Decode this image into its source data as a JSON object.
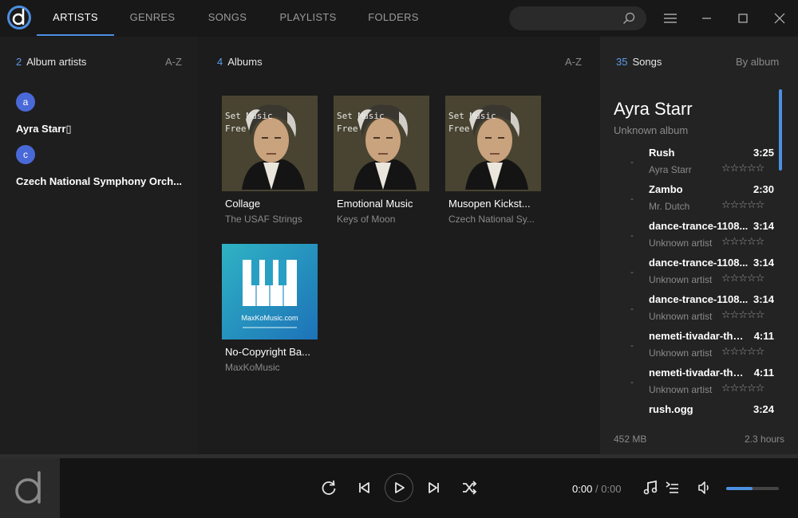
{
  "nav": {
    "tabs": [
      {
        "label": "ARTISTS",
        "active": true
      },
      {
        "label": "GENRES",
        "active": false
      },
      {
        "label": "SONGS",
        "active": false
      },
      {
        "label": "PLAYLISTS",
        "active": false
      },
      {
        "label": "FOLDERS",
        "active": false
      }
    ]
  },
  "search": {
    "value": "",
    "placeholder": ""
  },
  "album_artists_panel": {
    "count": "2",
    "title": "Album artists",
    "sort": "A-Z",
    "groups": [
      {
        "letter": "a",
        "artist": "Ayra Starr▯"
      },
      {
        "letter": "c",
        "artist": "Czech National Symphony Orch..."
      }
    ]
  },
  "albums_panel": {
    "count": "4",
    "title": "Albums",
    "sort": "A-Z",
    "albums": [
      {
        "title": "Collage",
        "artist": "The USAF Strings",
        "cover_text": [
          "Set Music",
          "Free"
        ],
        "cover": "portrait"
      },
      {
        "title": "Emotional Music",
        "artist": "Keys of Moon",
        "cover_text": [
          "Set Music",
          "Free"
        ],
        "cover": "portrait"
      },
      {
        "title": "Musopen Kickst...",
        "artist": "Czech National Sy...",
        "cover_text": [
          "Set Music",
          "Free"
        ],
        "cover": "portrait"
      },
      {
        "title": "No-Copyright Ba...",
        "artist": "MaxKoMusic",
        "cover_text": [
          "MaxKoMusic.com"
        ],
        "cover": "piano"
      }
    ]
  },
  "songs_panel": {
    "count": "35",
    "title": "Songs",
    "sort": "By album",
    "artist": "Ayra Starr",
    "album": "Unknown album",
    "songs": [
      {
        "title": "Rush",
        "duration": "3:25",
        "artist": "Ayra Starr",
        "rating": 0
      },
      {
        "title": "Zambo",
        "duration": "2:30",
        "artist": "Mr. Dutch",
        "rating": 0
      },
      {
        "title": "dance-trance-1108...",
        "duration": "3:14",
        "artist": "Unknown artist",
        "rating": 0
      },
      {
        "title": "dance-trance-1108...",
        "duration": "3:14",
        "artist": "Unknown artist",
        "rating": 0
      },
      {
        "title": "dance-trance-1108...",
        "duration": "3:14",
        "artist": "Unknown artist",
        "rating": 0
      },
      {
        "title": "nemeti-tivadar-the-...",
        "duration": "4:11",
        "artist": "Unknown artist",
        "rating": 0
      },
      {
        "title": "nemeti-tivadar-the-...",
        "duration": "4:11",
        "artist": "Unknown artist",
        "rating": 0
      },
      {
        "title": "rush.ogg",
        "duration": "3:24",
        "artist": "",
        "rating": 0
      }
    ],
    "size": "452 MB",
    "duration_total": "2.3 hours"
  },
  "player": {
    "current_time": "0:00",
    "separator": "/",
    "total_time": "0:00",
    "volume": 0.5,
    "icons": [
      "loop-icon",
      "previous-icon",
      "play-icon",
      "next-icon",
      "shuffle-icon",
      "now-playing-icon",
      "queue-icon",
      "volume-icon"
    ]
  },
  "colors": {
    "accent": "#4d8fe3",
    "badge": "#4a69d8"
  }
}
